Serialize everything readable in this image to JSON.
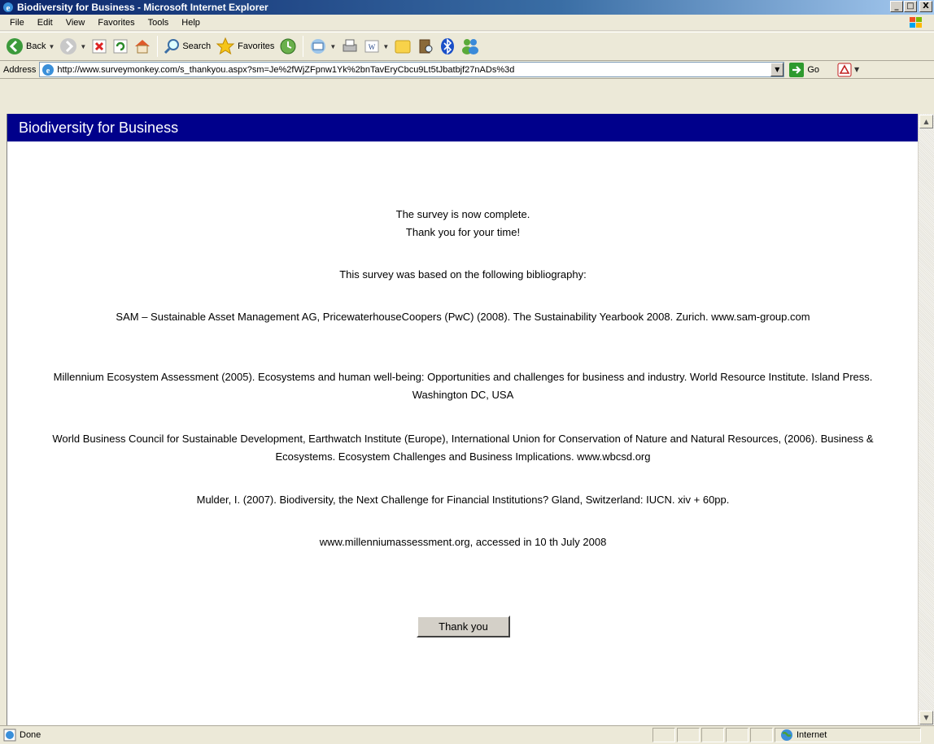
{
  "window": {
    "title": "Biodiversity for Business - Microsoft Internet Explorer",
    "controls": [
      "_",
      "□",
      "X"
    ]
  },
  "menu": [
    "File",
    "Edit",
    "View",
    "Favorites",
    "Tools",
    "Help"
  ],
  "toolbar": {
    "back_label": "Back",
    "search_label": "Search",
    "favorites_label": "Favorites"
  },
  "address": {
    "label": "Address",
    "url": "http://www.surveymonkey.com/s_thankyou.aspx?sm=Je%2fWjZFpnw1Yk%2bnTavEryCbcu9Lt5tJbatbjf27nADs%3d",
    "go_label": "Go"
  },
  "page": {
    "banner_title": "Biodiversity for Business",
    "line1": "The survey is now complete.",
    "line2": "Thank you for your time!",
    "intro": "This survey was based on the following bibliography:",
    "references": [
      "SAM – Sustainable Asset Management AG, PricewaterhouseCoopers (PwC) (2008). The Sustainability Yearbook 2008. Zurich. www.sam-group.com",
      "Millennium Ecosystem Assessment (2005). Ecosystems and human well-being: Opportunities and challenges for business and industry. World Resource Institute. Island Press. Washington DC, USA",
      "World Business Council for Sustainable Development, Earthwatch Institute (Europe), International Union for Conservation of Nature and Natural Resources, (2006). Business & Ecosystems. Ecosystem Challenges and Business Implications. www.wbcsd.org",
      "Mulder, I. (2007). Biodiversity, the Next Challenge for Financial Institutions? Gland, Switzerland: IUCN. xiv + 60pp.",
      "www.millenniumassessment.org, accessed in 10 th July 2008"
    ],
    "button_label": "Thank you"
  },
  "status": {
    "text": "Done",
    "zone": "Internet"
  },
  "colors": {
    "banner": "#00008b",
    "titlebar": "#0a246a",
    "chrome": "#ece9d8"
  }
}
